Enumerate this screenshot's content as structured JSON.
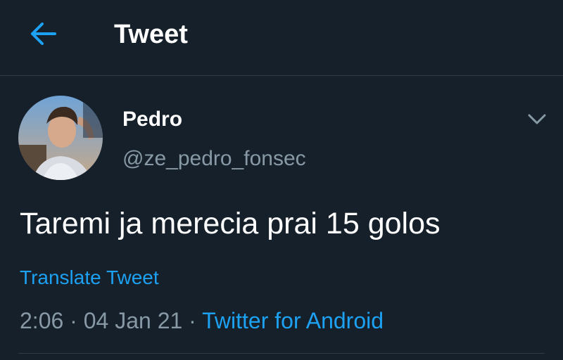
{
  "header": {
    "title": "Tweet",
    "back_icon": "back-arrow-icon"
  },
  "tweet": {
    "author": {
      "display_name": "Pedro",
      "handle": "@ze_pedro_fonsec"
    },
    "text": "Taremi ja merecia prai 15 golos",
    "translate_label": "Translate Tweet",
    "time": "2:06",
    "date": "04 Jan 21",
    "separator": "·",
    "source": "Twitter for Android",
    "menu_icon": "chevron-down-icon"
  },
  "colors": {
    "background": "#15202b",
    "accent": "#1da1f2",
    "secondary_text": "#8899a6",
    "divider": "#2f3b47"
  }
}
